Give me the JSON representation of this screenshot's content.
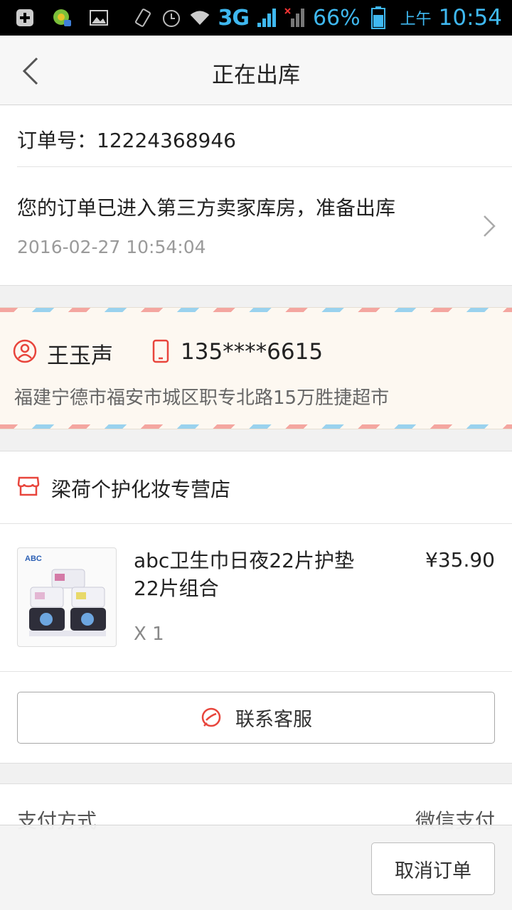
{
  "status_bar": {
    "network": "3G",
    "battery_percent": "66%",
    "ampm": "上午",
    "time": "10:54",
    "icons": [
      "add-notification-icon",
      "app-notification-icon",
      "image-icon",
      "vibrate-icon",
      "alarm-icon",
      "wifi-icon",
      "signal-3g-icon",
      "signal-no-sim-icon",
      "battery-icon"
    ]
  },
  "header": {
    "title": "正在出库",
    "back_icon": "chevron-left-icon"
  },
  "order": {
    "number_text": "订单号：12224368946",
    "status_text": "您的订单已进入第三方卖家库房，准备出库",
    "status_time": "2016-02-27 10:54:04"
  },
  "address": {
    "name": "王玉声",
    "phone": "135****6615",
    "address": "福建宁德市福安市城区职专北路15万胜捷超市"
  },
  "shop": {
    "name": "梁荷个护化妆专营店"
  },
  "product": {
    "name": "abc卫生巾日夜22片护垫22片组合",
    "price": "¥35.90",
    "quantity": "X 1",
    "thumb_brand": "ABC"
  },
  "contact": {
    "label": "联系客服"
  },
  "payment": {
    "label": "支付方式",
    "value": "微信支付"
  },
  "bottom": {
    "cancel_label": "取消订单"
  },
  "colors": {
    "accent_red": "#e8453c",
    "status_blue": "#3fb8f0",
    "airmail_red": "#f4a6a0",
    "airmail_blue": "#9ad2ee"
  }
}
